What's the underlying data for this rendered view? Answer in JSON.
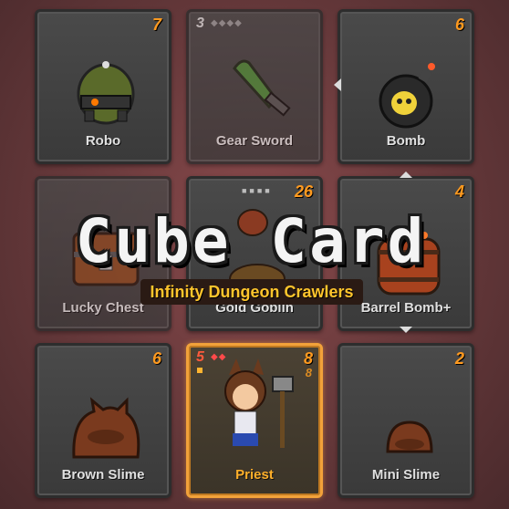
{
  "cards": [
    {
      "name": "Robo",
      "count": "7",
      "level": "",
      "diamonds": "",
      "icon": "robo-icon",
      "faded": false,
      "selected": false
    },
    {
      "name": "Gear Sword",
      "count": "",
      "level": "3",
      "diamonds": "◆◆◆◆",
      "icon": "gear-sword-icon",
      "faded": true,
      "selected": false
    },
    {
      "name": "Bomb",
      "count": "6",
      "level": "",
      "diamonds": "",
      "icon": "bomb-icon",
      "faded": false,
      "selected": false
    },
    {
      "name": "Lucky Chest",
      "count": "",
      "level": "",
      "diamonds": "",
      "icon": "chest-icon",
      "faded": true,
      "selected": false
    },
    {
      "name": "Gold Goblin",
      "count": "26",
      "level": "",
      "dots": "■■■■",
      "icon": "gold-goblin-icon",
      "faded": false,
      "selected": false
    },
    {
      "name": "Barrel Bomb+",
      "count": "4",
      "level": "",
      "diamonds": "",
      "icon": "barrel-bomb-icon",
      "faded": false,
      "selected": false
    },
    {
      "name": "Brown Slime",
      "count": "6",
      "level": "",
      "diamonds": "",
      "icon": "brown-slime-icon",
      "faded": false,
      "selected": false
    },
    {
      "name": "Priest",
      "count": "8",
      "level": "5",
      "diamonds": "◆◆",
      "sub": "8",
      "icon": "priest-icon",
      "faded": false,
      "selected": true
    },
    {
      "name": "Mini Slime",
      "count": "2",
      "level": "",
      "diamonds": "",
      "icon": "mini-slime-icon",
      "faded": false,
      "selected": false
    }
  ],
  "logo": {
    "title": "Cube Card",
    "subtitle": "Infinity Dungeon Crawlers"
  },
  "colors": {
    "accent": "#ff9a1f",
    "selected_border": "#f2a23a",
    "logo_sub": "#ffc52c"
  }
}
